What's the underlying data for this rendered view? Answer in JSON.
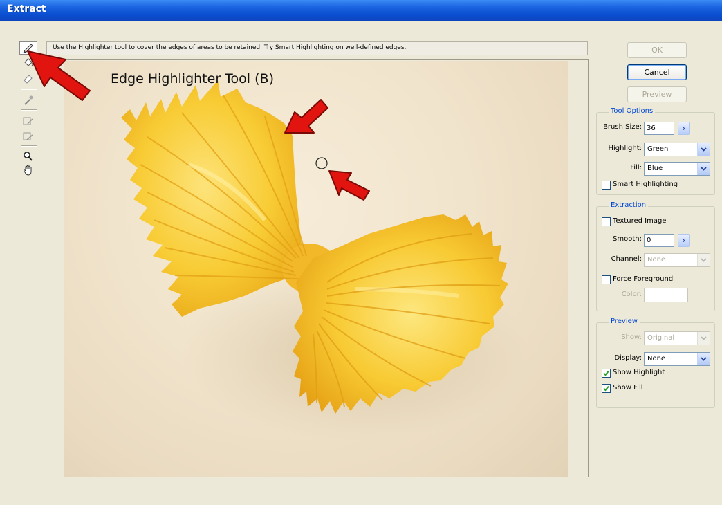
{
  "window": {
    "title": "Extract"
  },
  "hint": "Use the Highlighter tool to cover the edges of areas to be retained. Try Smart Highlighting on well-defined edges.",
  "callout": "Edge Highlighter Tool (B)",
  "toolbar": {
    "tools": [
      "edge-highlighter-icon",
      "fill-icon",
      "eraser-icon",
      "eyedropper-icon",
      "cleanup-icon",
      "edge-touchup-icon",
      "zoom-icon",
      "hand-icon"
    ],
    "active": "edge-highlighter-icon"
  },
  "buttons": {
    "ok": "OK",
    "cancel": "Cancel",
    "preview": "Preview"
  },
  "tool_options": {
    "title": "Tool Options",
    "brush_size_label": "Brush Size:",
    "brush_size_value": "36",
    "highlight_label": "Highlight:",
    "highlight_value": "Green",
    "fill_label": "Fill:",
    "fill_value": "Blue",
    "smart_highlighting_label": "Smart Highlighting",
    "smart_highlighting_checked": false
  },
  "extraction": {
    "title": "Extraction",
    "textured_image_label": "Textured Image",
    "textured_image_checked": false,
    "smooth_label": "Smooth:",
    "smooth_value": "0",
    "channel_label": "Channel:",
    "channel_value": "None",
    "force_foreground_label": "Force Foreground",
    "force_foreground_checked": false,
    "color_label": "Color:"
  },
  "preview": {
    "title": "Preview",
    "show_label": "Show:",
    "show_value": "Original",
    "display_label": "Display:",
    "display_value": "None",
    "show_highlight_label": "Show Highlight",
    "show_highlight_checked": true,
    "show_fill_label": "Show Fill",
    "show_fill_checked": true
  },
  "colors": {
    "titlebar": "#0a4fd0",
    "group_title": "#0046d5",
    "annotation_arrow": "#e1140f",
    "pasta": "#f6c72a"
  }
}
